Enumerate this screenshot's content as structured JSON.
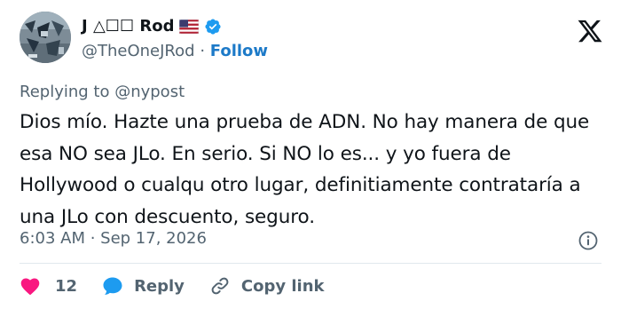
{
  "header": {
    "display_name": "J △☐☐ Rod",
    "handle": "@TheOneJRod",
    "separator": "·",
    "follow_label": "Follow"
  },
  "body": {
    "replying_to": "Replying to @nypost",
    "text": "Dios mío. Hazte una prueba de ADN. No hay manera de que esa NO sea JLo. En serio. Si NO lo es... y yo fuera de Hollywood o cualqu otro lugar, definitiamente contrataría a una JLo con descuento, seguro.",
    "timestamp": "6:03 AM · Sep 17, 2026"
  },
  "actions": {
    "like_count": "12",
    "reply_label": "Reply",
    "copy_label": "Copy link"
  },
  "icons": {
    "brand": "x-logo-icon",
    "verified": "verified-badge-icon",
    "flag": "us-flag-icon",
    "info": "info-icon",
    "like": "heart-icon",
    "reply": "speech-bubble-icon",
    "copy": "link-icon"
  },
  "colors": {
    "link_blue": "#1d7ac8",
    "verified_blue": "#1d9bf0",
    "like_pink": "#f91880",
    "reply_blue": "#1d9bf0",
    "secondary_text": "#536471",
    "primary_text": "#0f1419"
  }
}
